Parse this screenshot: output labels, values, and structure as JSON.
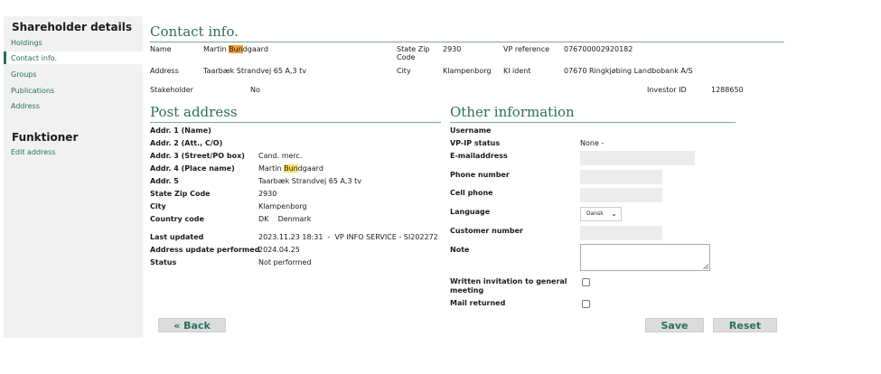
{
  "sidebar": {
    "heading1": "Shareholder details",
    "items": [
      {
        "label": "Holdings"
      },
      {
        "label": "Contact info."
      },
      {
        "label": "Groups"
      },
      {
        "label": "Publications"
      },
      {
        "label": "Address"
      }
    ],
    "heading2": "Funktioner",
    "functions": [
      {
        "label": "Edit address"
      }
    ]
  },
  "contact": {
    "title": "Contact info.",
    "name_label": "Name",
    "name_prefix": "Martin ",
    "name_highlight": "Bun",
    "name_suffix": "dgaard",
    "address_label": "Address",
    "address_value": "Taarbæk Strandvej 65 A,3 tv",
    "state_zip_label": "State Zip Code",
    "state_zip_value": "2930",
    "city_label": "City",
    "city_value": "Klampenborg",
    "vp_reference_label": "VP reference",
    "vp_reference_value": "076700002920182",
    "kl_ident_label": "Kl ident",
    "kl_ident_value": "07670 Ringkjøbing Landbobank A/S",
    "stakeholder_label": "Stakeholder",
    "stakeholder_value": "No",
    "investor_id_label": "Investor ID",
    "investor_id_value": "1288650"
  },
  "post": {
    "title": "Post address",
    "rows": [
      {
        "label": "Addr. 1 (Name)",
        "value": ""
      },
      {
        "label": "Addr. 2 (Att., C/O)",
        "value": ""
      },
      {
        "label": "Addr. 3 (Street/PO box)",
        "value": "Cand. merc."
      },
      {
        "label": "Addr. 4 (Place name)",
        "value": ""
      },
      {
        "label": "Addr. 5",
        "value": "Taarbæk Strandvej 65 A,3 tv"
      },
      {
        "label": "State Zip Code",
        "value": "2930"
      },
      {
        "label": "City",
        "value": "Klampenborg"
      },
      {
        "label": "Country code",
        "value": "DK    Denmark"
      }
    ],
    "addr4_prefix": "Martin ",
    "addr4_highlight": "Bun",
    "addr4_suffix": "dgaard",
    "last_updated_label": "Last updated",
    "last_updated_value": "2023.11.23 18:31  -  VP INFO SERVICE - SI202272",
    "performed_label": "Address update performed",
    "performed_value": "2024.04.25",
    "status_label": "Status",
    "status_value": "Not performed"
  },
  "other": {
    "title": "Other information",
    "username_label": "Username",
    "vpip_label": "VP-IP status",
    "vpip_value": "None -",
    "email_label": "E-mailaddress",
    "phone_label": "Phone number",
    "cell_label": "Cell phone",
    "language_label": "Language",
    "language_value": "Dansk",
    "customer_label": "Customer number",
    "note_label": "Note",
    "invitation_label_1": "Written invitation to general",
    "invitation_label_2": "meeting",
    "mail_returned_label": "Mail returned"
  },
  "buttons": {
    "back": "« Back",
    "save": "Save",
    "reset": "Reset"
  },
  "colors": {
    "accent": "#2b6f5e",
    "highlight": "#f7e36a",
    "highlight_orange": "#f0a23b"
  }
}
